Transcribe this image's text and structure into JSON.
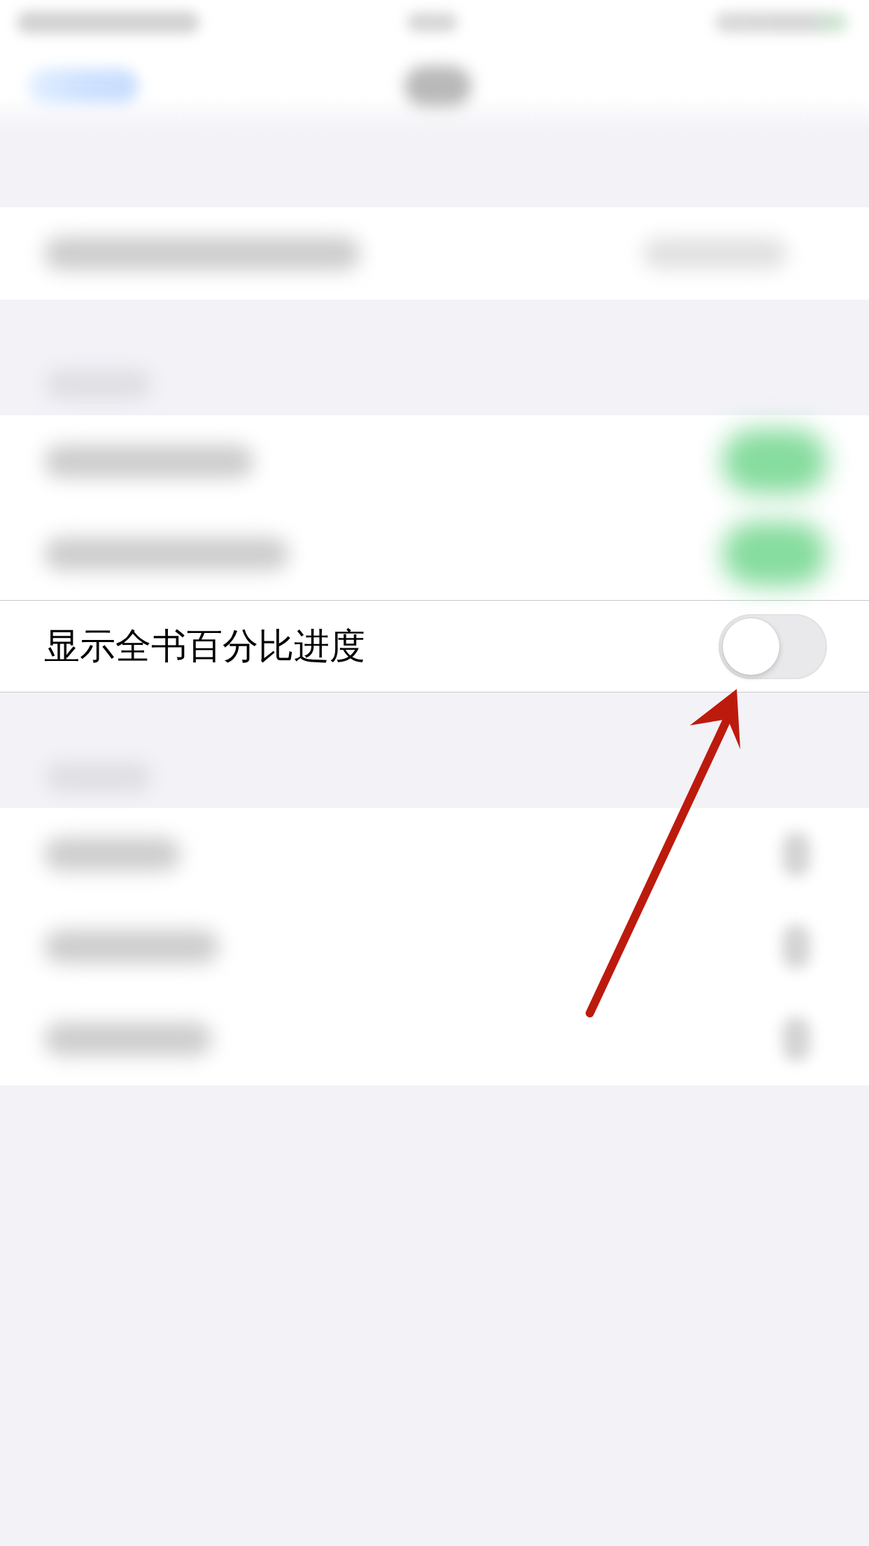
{
  "groups": [
    {
      "rows": [
        {
          "kind": "value",
          "blurred": true
        }
      ]
    },
    {
      "has_header": true,
      "rows": [
        {
          "kind": "switch",
          "blurred": true,
          "on": true
        },
        {
          "kind": "switch",
          "blurred": true,
          "on": true
        },
        {
          "kind": "switch",
          "blurred": false,
          "on": false,
          "label": "显示全书百分比进度"
        }
      ]
    },
    {
      "has_header": true,
      "rows": [
        {
          "kind": "link",
          "blurred": true
        },
        {
          "kind": "link",
          "blurred": true
        },
        {
          "kind": "link",
          "blurred": true
        }
      ]
    }
  ],
  "annotation": {
    "kind": "arrow"
  }
}
